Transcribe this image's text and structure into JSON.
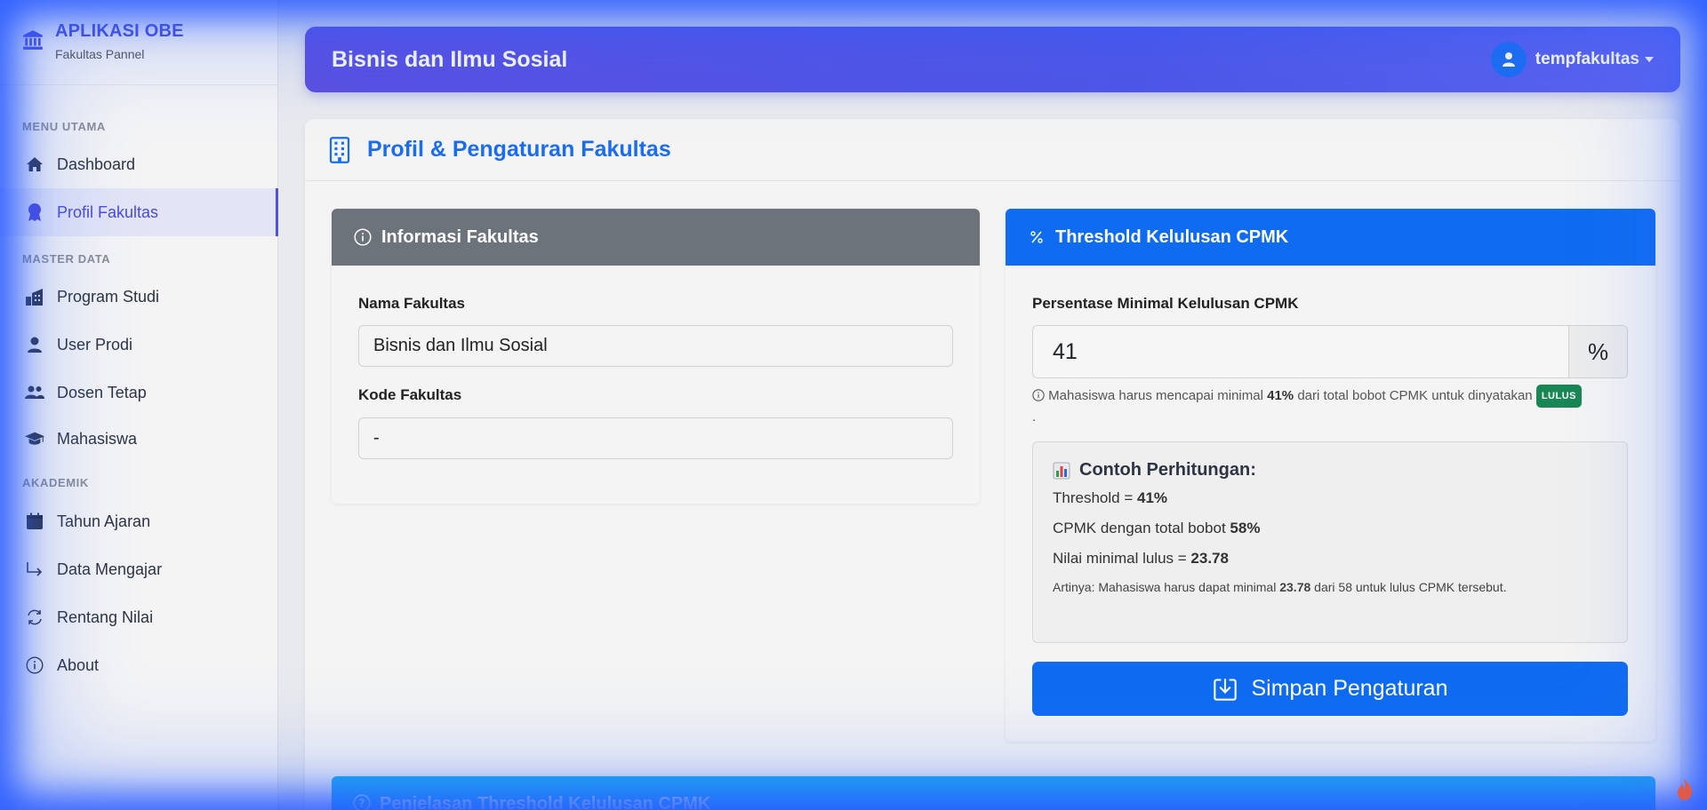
{
  "brand": {
    "title": "APLIKASI OBE",
    "subtitle": "Fakultas Pannel"
  },
  "sidebar": {
    "sections": [
      "MENU UTAMA",
      "MASTER DATA",
      "AKADEMIK"
    ],
    "items": [
      {
        "label": "Dashboard",
        "icon": "home-icon"
      },
      {
        "label": "Profil Fakultas",
        "icon": "award-icon",
        "active": true
      },
      {
        "label": "Program Studi",
        "icon": "building-icon"
      },
      {
        "label": "User Prodi",
        "icon": "user-icon"
      },
      {
        "label": "Dosen Tetap",
        "icon": "users-icon"
      },
      {
        "label": "Mahasiswa",
        "icon": "graduation-cap-icon"
      },
      {
        "label": "Tahun Ajaran",
        "icon": "calendar-icon"
      },
      {
        "label": "Data Mengajar",
        "icon": "arrow-return-icon"
      },
      {
        "label": "Rentang Nilai",
        "icon": "refresh-icon"
      },
      {
        "label": "About",
        "icon": "info-icon"
      }
    ]
  },
  "header": {
    "title": "Bisnis dan Ilmu Sosial",
    "username": "tempfakultas"
  },
  "page": {
    "title": "Profil & Pengaturan Fakultas"
  },
  "info_panel": {
    "title": "Informasi Fakultas",
    "nama_label": "Nama Fakultas",
    "nama_value": "Bisnis dan Ilmu Sosial",
    "kode_label": "Kode Fakultas",
    "kode_value": "-"
  },
  "threshold_panel": {
    "title": "Threshold Kelulusan CPMK",
    "field_label": "Persentase Minimal Kelulusan CPMK",
    "value": "41",
    "unit": "%",
    "hint_prefix": "Mahasiswa harus mencapai minimal",
    "hint_value": "41%",
    "hint_suffix": "dari total bobot CPMK untuk dinyatakan",
    "badge": "LULUS",
    "hint_end": ".",
    "example": {
      "title": "Contoh Perhitungan:",
      "line1_label": "Threshold =",
      "line1_value": "41%",
      "line2_label": "CPMK dengan total bobot",
      "line2_value": "58%",
      "line3_label": "Nilai minimal lulus =",
      "line3_value": "23.78",
      "note_prefix": "Artinya: Mahasiswa harus dapat minimal",
      "note_value": "23.78",
      "note_suffix": "dari 58 untuk lulus CPMK tersebut."
    },
    "save_label": "Simpan Pengaturan"
  },
  "explain": {
    "title": "Penjelasan Threshold Kelulusan CPMK"
  },
  "colors": {
    "accent": "#4a4ad8",
    "primary": "#0f6cf0",
    "info": "#1bb0ef",
    "success": "#198754",
    "secondary": "#6c737a"
  }
}
